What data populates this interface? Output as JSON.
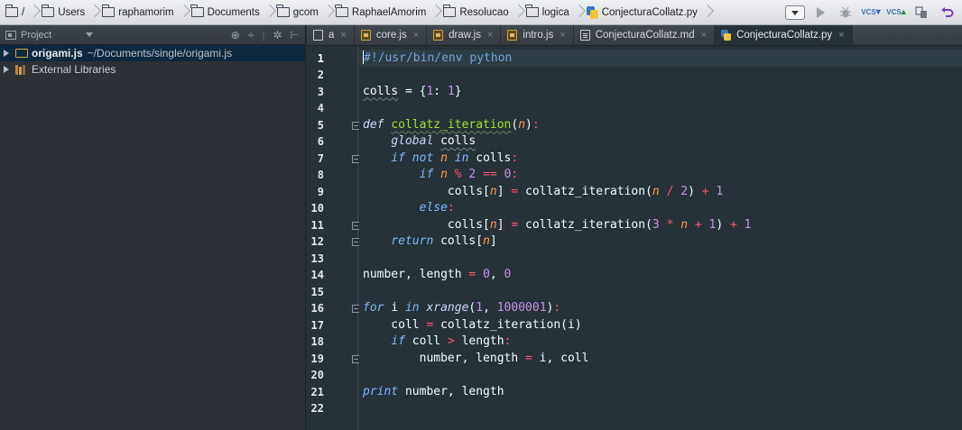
{
  "breadcrumbs": [
    {
      "label": "/",
      "icon": "folder-icon"
    },
    {
      "label": "Users",
      "icon": "folder-icon"
    },
    {
      "label": "raphamorim",
      "icon": "folder-icon"
    },
    {
      "label": "Documents",
      "icon": "folder-icon"
    },
    {
      "label": "gcom",
      "icon": "folder-icon"
    },
    {
      "label": "RaphaelAmorim",
      "icon": "folder-icon"
    },
    {
      "label": "Resolucao",
      "icon": "folder-icon"
    },
    {
      "label": "logica",
      "icon": "folder-icon"
    },
    {
      "label": "ConjecturaCollatz.py",
      "icon": "python-file-icon"
    }
  ],
  "toolbar": {
    "vcs_update_label": "VCS",
    "vcs_commit_label": "VCS"
  },
  "project_panel": {
    "title": "Project",
    "tree": [
      {
        "name": "origami.js",
        "path": "~/Documents/single/origami.js",
        "selected": true
      },
      {
        "name": "External Libraries",
        "path": "",
        "selected": false
      }
    ]
  },
  "tabs": [
    {
      "label": "a",
      "icon": "plain-file-icon",
      "active": false
    },
    {
      "label": "core.js",
      "icon": "js-file-icon",
      "active": false
    },
    {
      "label": "draw.js",
      "icon": "js-file-icon",
      "active": false
    },
    {
      "label": "intro.js",
      "icon": "js-file-icon",
      "active": false
    },
    {
      "label": "ConjecturaCollatz.md",
      "icon": "markdown-file-icon",
      "active": false
    },
    {
      "label": "ConjecturaCollatz.py",
      "icon": "python-file-icon",
      "active": true
    }
  ],
  "tab_close_glyph": "×",
  "editor": {
    "line_numbers": [
      "1",
      "2",
      "3",
      "4",
      "5",
      "6",
      "7",
      "8",
      "9",
      "10",
      "11",
      "12",
      "13",
      "14",
      "15",
      "16",
      "17",
      "18",
      "19",
      "20",
      "21",
      "22"
    ],
    "lines": [
      [
        {
          "t": "#!/usr/bin/env python",
          "c": "com"
        }
      ],
      [],
      [
        {
          "t": "colls",
          "c": "var under"
        },
        {
          "t": " = {",
          "c": ""
        },
        {
          "t": "1",
          "c": "num"
        },
        {
          "t": ": ",
          "c": ""
        },
        {
          "t": "1",
          "c": "num"
        },
        {
          "t": "}",
          "c": ""
        }
      ],
      [],
      [
        {
          "t": "def ",
          "c": "kw"
        },
        {
          "t": "collatz_iteration",
          "c": "fn under-fn"
        },
        {
          "t": "(",
          "c": ""
        },
        {
          "t": "n",
          "c": "par"
        },
        {
          "t": ")",
          "c": ""
        },
        {
          "t": ":",
          "c": "op"
        }
      ],
      [
        {
          "t": "    ",
          "c": ""
        },
        {
          "t": "global ",
          "c": "kw"
        },
        {
          "t": "colls",
          "c": "var under"
        }
      ],
      [
        {
          "t": "    ",
          "c": ""
        },
        {
          "t": "if not ",
          "c": "kwp"
        },
        {
          "t": "n",
          "c": "par"
        },
        {
          "t": " in ",
          "c": "kwp"
        },
        {
          "t": "colls",
          "c": ""
        },
        {
          "t": ":",
          "c": "op"
        }
      ],
      [
        {
          "t": "        ",
          "c": ""
        },
        {
          "t": "if ",
          "c": "kwp"
        },
        {
          "t": "n",
          "c": "par"
        },
        {
          "t": " % ",
          "c": "op"
        },
        {
          "t": "2",
          "c": "num"
        },
        {
          "t": " == ",
          "c": "op"
        },
        {
          "t": "0",
          "c": "num"
        },
        {
          "t": ":",
          "c": "op"
        }
      ],
      [
        {
          "t": "            colls[",
          "c": ""
        },
        {
          "t": "n",
          "c": "par"
        },
        {
          "t": "] ",
          "c": ""
        },
        {
          "t": "=",
          "c": "op"
        },
        {
          "t": " collatz_iteration(",
          "c": ""
        },
        {
          "t": "n",
          "c": "par"
        },
        {
          "t": " / ",
          "c": "op"
        },
        {
          "t": "2",
          "c": "num"
        },
        {
          "t": ") ",
          "c": ""
        },
        {
          "t": "+",
          "c": "op"
        },
        {
          "t": " 1",
          "c": "num"
        }
      ],
      [
        {
          "t": "        ",
          "c": ""
        },
        {
          "t": "else",
          "c": "kwp"
        },
        {
          "t": ":",
          "c": "op"
        }
      ],
      [
        {
          "t": "            colls[",
          "c": ""
        },
        {
          "t": "n",
          "c": "par"
        },
        {
          "t": "] ",
          "c": ""
        },
        {
          "t": "=",
          "c": "op"
        },
        {
          "t": " collatz_iteration(",
          "c": ""
        },
        {
          "t": "3",
          "c": "num"
        },
        {
          "t": " * ",
          "c": "op"
        },
        {
          "t": "n",
          "c": "par"
        },
        {
          "t": " + ",
          "c": "op"
        },
        {
          "t": "1",
          "c": "num"
        },
        {
          "t": ") ",
          "c": ""
        },
        {
          "t": "+",
          "c": "op"
        },
        {
          "t": " 1",
          "c": "num"
        }
      ],
      [
        {
          "t": "    ",
          "c": ""
        },
        {
          "t": "return ",
          "c": "kwp"
        },
        {
          "t": "colls[",
          "c": ""
        },
        {
          "t": "n",
          "c": "par"
        },
        {
          "t": "]",
          "c": ""
        }
      ],
      [],
      [
        {
          "t": "number, length ",
          "c": ""
        },
        {
          "t": "=",
          "c": "op"
        },
        {
          "t": " ",
          "c": ""
        },
        {
          "t": "0",
          "c": "num"
        },
        {
          "t": ", ",
          "c": ""
        },
        {
          "t": "0",
          "c": "num"
        }
      ],
      [],
      [
        {
          "t": "for ",
          "c": "kwp"
        },
        {
          "t": "i ",
          "c": ""
        },
        {
          "t": "in ",
          "c": "kwp"
        },
        {
          "t": "xrange",
          "c": "kw"
        },
        {
          "t": "(",
          "c": ""
        },
        {
          "t": "1",
          "c": "num"
        },
        {
          "t": ", ",
          "c": ""
        },
        {
          "t": "1000001",
          "c": "num"
        },
        {
          "t": ")",
          "c": ""
        },
        {
          "t": ":",
          "c": "op"
        }
      ],
      [
        {
          "t": "    coll ",
          "c": ""
        },
        {
          "t": "=",
          "c": "op"
        },
        {
          "t": " collatz_iteration(i)",
          "c": ""
        }
      ],
      [
        {
          "t": "    ",
          "c": ""
        },
        {
          "t": "if ",
          "c": "kwp"
        },
        {
          "t": "coll ",
          "c": ""
        },
        {
          "t": ">",
          "c": "op"
        },
        {
          "t": " length",
          "c": ""
        },
        {
          "t": ":",
          "c": "op"
        }
      ],
      [
        {
          "t": "        number, length ",
          "c": ""
        },
        {
          "t": "=",
          "c": "op"
        },
        {
          "t": " i, coll",
          "c": ""
        }
      ],
      [],
      [
        {
          "t": "print ",
          "c": "kwp"
        },
        {
          "t": "number, length",
          "c": ""
        }
      ],
      []
    ],
    "fold_open_lines": [
      5,
      7,
      16
    ],
    "fold_end_lines": [
      11,
      12,
      19
    ]
  },
  "colors": {
    "editor_bg": "#263238",
    "keyword": "#7fb8ff",
    "function": "#a6e22e",
    "number": "#c792ea",
    "operator": "#ff5370",
    "parameter": "#ff9d4d",
    "comment": "#6fa8dc"
  }
}
